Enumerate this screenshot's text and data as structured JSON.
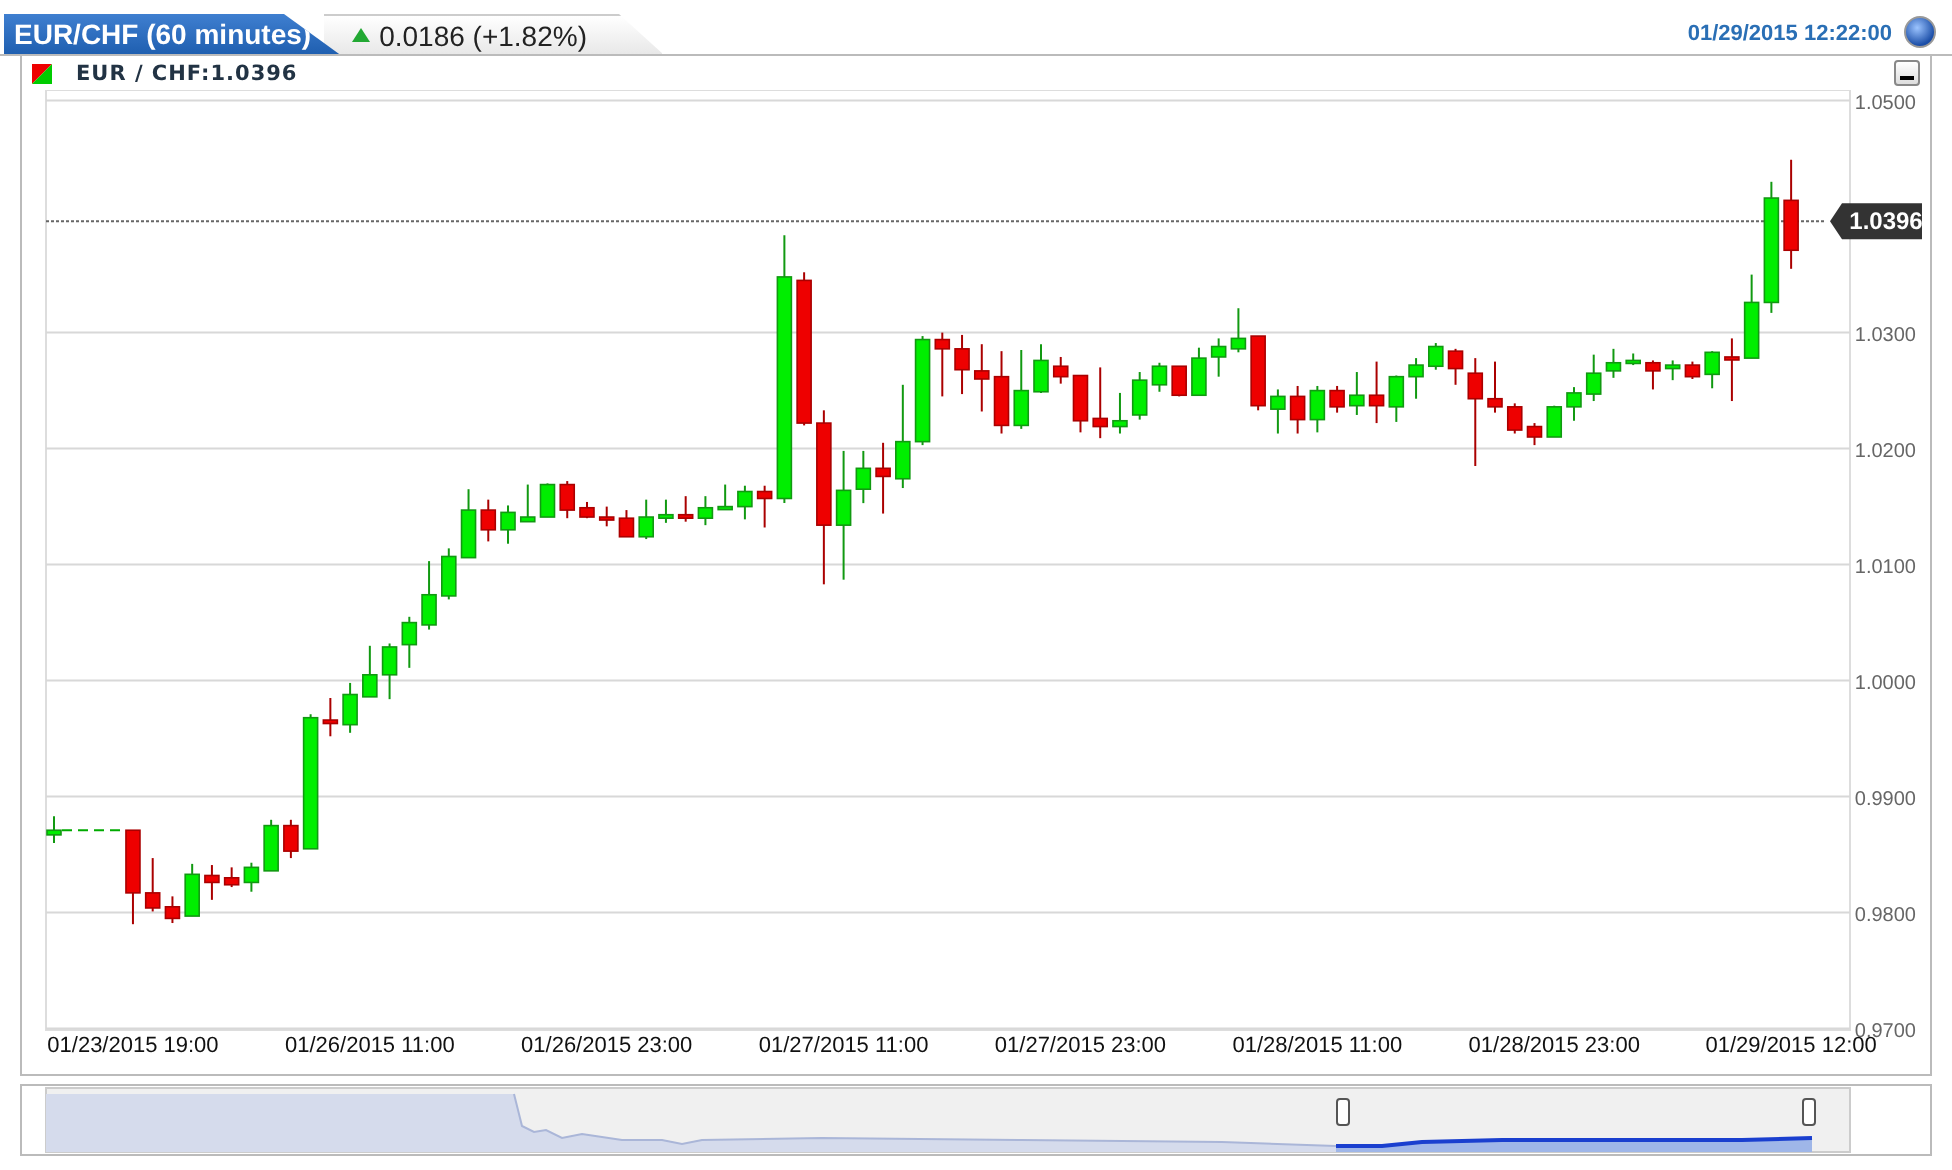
{
  "header": {
    "tab_title": "EUR/CHF (60 minutes)",
    "rising": true,
    "change": "0.0186 (+1.82%)",
    "timestamp": "01/29/2015 12:22:00"
  },
  "legend": {
    "label": "EUR / CHF:1.0396"
  },
  "chart": {
    "chart_data": {
      "type": "candlestick",
      "ylim": [
        0.97,
        1.05
      ],
      "grid": true,
      "yticks": [
        {
          "value": 0.97,
          "label": "0.9700"
        },
        {
          "value": 0.98,
          "label": "0.9800"
        },
        {
          "value": 0.99,
          "label": "0.9900"
        },
        {
          "value": 1.0,
          "label": "1.0000"
        },
        {
          "value": 1.01,
          "label": "1.0100"
        },
        {
          "value": 1.02,
          "label": "1.0200"
        },
        {
          "value": 1.03,
          "label": "1.0300"
        },
        {
          "value": 1.05,
          "label": "1.0500"
        }
      ],
      "categories": [
        null,
        null,
        null,
        null,
        "01/23/2015 19:00",
        null,
        null,
        null,
        null,
        null,
        null,
        null,
        null,
        null,
        null,
        null,
        "01/26/2015 11:00",
        null,
        null,
        null,
        null,
        null,
        null,
        null,
        null,
        null,
        null,
        null,
        "01/26/2015 23:00",
        null,
        null,
        null,
        null,
        null,
        null,
        null,
        null,
        null,
        null,
        null,
        "01/27/2015 11:00",
        null,
        null,
        null,
        null,
        null,
        null,
        null,
        null,
        null,
        null,
        null,
        "01/27/2015 23:00",
        null,
        null,
        null,
        null,
        null,
        null,
        null,
        null,
        null,
        null,
        null,
        "01/28/2015 11:00",
        null,
        null,
        null,
        null,
        null,
        null,
        null,
        null,
        null,
        null,
        null,
        "01/28/2015 23:00",
        null,
        null,
        null,
        null,
        null,
        null,
        null,
        null,
        null,
        null,
        null,
        "01/29/2015 12:00"
      ],
      "ref_lines": [
        {
          "axis": "y",
          "value": 1.0396,
          "label": "1.0396"
        }
      ],
      "ohlc": [
        [
          0.9867,
          0.9883,
          0.986,
          0.9871
        ],
        null,
        null,
        null,
        [
          0.9871,
          0.9871,
          0.979,
          0.9817
        ],
        [
          0.9817,
          0.9847,
          0.9801,
          0.9804
        ],
        [
          0.9805,
          0.9814,
          0.9791,
          0.9795
        ],
        [
          0.9797,
          0.9842,
          0.9797,
          0.9833
        ],
        [
          0.9832,
          0.9841,
          0.9811,
          0.9826
        ],
        [
          0.983,
          0.9839,
          0.9822,
          0.9824
        ],
        [
          0.9826,
          0.9843,
          0.9818,
          0.9839
        ],
        [
          0.9836,
          0.988,
          0.9836,
          0.9875
        ],
        [
          0.9875,
          0.988,
          0.9847,
          0.9853
        ],
        [
          0.9855,
          0.9971,
          0.9855,
          0.9968
        ],
        [
          0.9966,
          0.9985,
          0.9952,
          0.9963
        ],
        [
          0.9962,
          0.9998,
          0.9955,
          0.9988
        ],
        [
          0.9986,
          1.003,
          0.9986,
          1.0005
        ],
        [
          1.0005,
          1.0032,
          0.9984,
          1.0029
        ],
        [
          1.0031,
          1.0055,
          1.0011,
          1.005
        ],
        [
          1.0048,
          1.0103,
          1.0044,
          1.0074
        ],
        [
          1.0073,
          1.0114,
          1.007,
          1.0107
        ],
        [
          1.0106,
          1.0165,
          1.0106,
          1.0147
        ],
        [
          1.0147,
          1.0156,
          1.012,
          1.013
        ],
        [
          1.013,
          1.0151,
          1.0118,
          1.0145
        ],
        [
          1.0137,
          1.0169,
          1.0137,
          1.0141
        ],
        [
          1.0141,
          1.017,
          1.0141,
          1.0169
        ],
        [
          1.0169,
          1.0172,
          1.014,
          1.0147
        ],
        [
          1.0149,
          1.0154,
          1.014,
          1.0141
        ],
        [
          1.0141,
          1.015,
          1.0133,
          1.014
        ],
        [
          1.014,
          1.0147,
          1.0124,
          1.0124
        ],
        [
          1.0124,
          1.0156,
          1.0122,
          1.0141
        ],
        [
          1.014,
          1.0156,
          1.0136,
          1.0143
        ],
        [
          1.0143,
          1.0159,
          1.0137,
          1.014
        ],
        [
          1.014,
          1.0159,
          1.0134,
          1.0149
        ],
        [
          1.0149,
          1.0169,
          1.0148,
          1.015
        ],
        [
          1.015,
          1.0168,
          1.0139,
          1.0163
        ],
        [
          1.0163,
          1.0168,
          1.0132,
          1.0157
        ],
        [
          1.0157,
          1.0384,
          1.0153,
          1.0348
        ],
        [
          1.0345,
          1.0352,
          1.022,
          1.0222
        ],
        [
          1.0222,
          1.0233,
          1.0083,
          1.0134
        ],
        [
          1.0134,
          1.0198,
          1.0087,
          1.0164
        ],
        [
          1.0165,
          1.0198,
          1.0153,
          1.0183
        ],
        [
          1.0183,
          1.0205,
          1.0144,
          1.0176
        ],
        [
          1.0174,
          1.0255,
          1.0166,
          1.0206
        ],
        [
          1.0206,
          1.0297,
          1.0203,
          1.0294
        ],
        [
          1.0294,
          1.03,
          1.0245,
          1.0286
        ],
        [
          1.0286,
          1.0298,
          1.0247,
          1.0268
        ],
        [
          1.0267,
          1.029,
          1.0232,
          1.026
        ],
        [
          1.0262,
          1.0284,
          1.0213,
          1.022
        ],
        [
          1.022,
          1.0285,
          1.0217,
          1.025
        ],
        [
          1.0249,
          1.029,
          1.0248,
          1.0276
        ],
        [
          1.0271,
          1.0279,
          1.0256,
          1.0262
        ],
        [
          1.0263,
          1.0263,
          1.0214,
          1.0224
        ],
        [
          1.0226,
          1.027,
          1.0209,
          1.0219
        ],
        [
          1.0219,
          1.0248,
          1.0213,
          1.0224
        ],
        [
          1.0229,
          1.0266,
          1.0225,
          1.0259
        ],
        [
          1.0255,
          1.0274,
          1.0249,
          1.0271
        ],
        [
          1.0271,
          1.0271,
          1.0245,
          1.0246
        ],
        [
          1.0246,
          1.0287,
          1.0246,
          1.0278
        ],
        [
          1.0279,
          1.0295,
          1.0262,
          1.0288
        ],
        [
          1.0286,
          1.0321,
          1.0283,
          1.0295
        ],
        [
          1.0297,
          1.0297,
          1.0233,
          1.0237
        ],
        [
          1.0234,
          1.0251,
          1.0213,
          1.0245
        ],
        [
          1.0245,
          1.0254,
          1.0213,
          1.0225
        ],
        [
          1.0225,
          1.0254,
          1.0214,
          1.025
        ],
        [
          1.025,
          1.0254,
          1.0231,
          1.0236
        ],
        [
          1.0237,
          1.0266,
          1.0229,
          1.0246
        ],
        [
          1.0246,
          1.0275,
          1.0222,
          1.0237
        ],
        [
          1.0236,
          1.0263,
          1.0223,
          1.0262
        ],
        [
          1.0262,
          1.0278,
          1.0243,
          1.0272
        ],
        [
          1.0271,
          1.0291,
          1.0268,
          1.0288
        ],
        [
          1.0284,
          1.0286,
          1.0255,
          1.0269
        ],
        [
          1.0265,
          1.0278,
          1.0185,
          1.0243
        ],
        [
          1.0243,
          1.0275,
          1.0231,
          1.0236
        ],
        [
          1.0236,
          1.0239,
          1.0213,
          1.0216
        ],
        [
          1.0219,
          1.0222,
          1.0203,
          1.021
        ],
        [
          1.021,
          1.0237,
          1.021,
          1.0236
        ],
        [
          1.0236,
          1.0253,
          1.0224,
          1.0248
        ],
        [
          1.0247,
          1.0281,
          1.0241,
          1.0265
        ],
        [
          1.0267,
          1.0286,
          1.0261,
          1.0274
        ],
        [
          1.0275,
          1.0282,
          1.0272,
          1.0276
        ],
        [
          1.0274,
          1.0276,
          1.0251,
          1.0267
        ],
        [
          1.0269,
          1.0276,
          1.0259,
          1.0272
        ],
        [
          1.0272,
          1.0275,
          1.026,
          1.0262
        ],
        [
          1.0264,
          1.0284,
          1.0252,
          1.0283
        ],
        [
          1.0279,
          1.0295,
          1.0241,
          1.0278
        ],
        [
          1.0278,
          1.035,
          1.0278,
          1.0326
        ],
        [
          1.0326,
          1.043,
          1.0317,
          1.0416
        ],
        [
          1.0414,
          1.0449,
          1.0355,
          1.0371
        ]
      ]
    }
  }
}
